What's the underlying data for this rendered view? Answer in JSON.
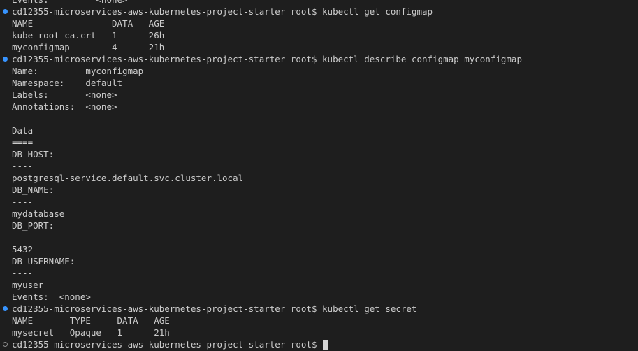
{
  "terminal": {
    "prompt": "cd12355-microservices-aws-kubernetes-project-starter root$",
    "lines": [
      {
        "type": "output",
        "text": "Events:         <none>"
      },
      {
        "type": "command",
        "status": "done",
        "text": "cd12355-microservices-aws-kubernetes-project-starter root$ kubectl get configmap"
      },
      {
        "type": "output",
        "text": "NAME               DATA   AGE"
      },
      {
        "type": "output",
        "text": "kube-root-ca.crt   1      26h"
      },
      {
        "type": "output",
        "text": "myconfigmap        4      21h"
      },
      {
        "type": "command",
        "status": "done",
        "text": "cd12355-microservices-aws-kubernetes-project-starter root$ kubectl describe configmap myconfigmap"
      },
      {
        "type": "output",
        "text": "Name:         myconfigmap"
      },
      {
        "type": "output",
        "text": "Namespace:    default"
      },
      {
        "type": "output",
        "text": "Labels:       <none>"
      },
      {
        "type": "output",
        "text": "Annotations:  <none>"
      },
      {
        "type": "output",
        "text": ""
      },
      {
        "type": "output",
        "text": "Data"
      },
      {
        "type": "output",
        "text": "===="
      },
      {
        "type": "output",
        "text": "DB_HOST:"
      },
      {
        "type": "output",
        "text": "----"
      },
      {
        "type": "output",
        "text": "postgresql-service.default.svc.cluster.local"
      },
      {
        "type": "output",
        "text": "DB_NAME:"
      },
      {
        "type": "output",
        "text": "----"
      },
      {
        "type": "output",
        "text": "mydatabase"
      },
      {
        "type": "output",
        "text": "DB_PORT:"
      },
      {
        "type": "output",
        "text": "----"
      },
      {
        "type": "output",
        "text": "5432"
      },
      {
        "type": "output",
        "text": "DB_USERNAME:"
      },
      {
        "type": "output",
        "text": "----"
      },
      {
        "type": "output",
        "text": "myuser"
      },
      {
        "type": "output",
        "text": "Events:  <none>"
      },
      {
        "type": "command",
        "status": "done",
        "text": "cd12355-microservices-aws-kubernetes-project-starter root$ kubectl get secret"
      },
      {
        "type": "output",
        "text": "NAME       TYPE     DATA   AGE"
      },
      {
        "type": "output",
        "text": "mysecret   Opaque   1      21h"
      },
      {
        "type": "command",
        "status": "pending",
        "text": "cd12355-microservices-aws-kubernetes-project-starter root$ ",
        "cursor": true
      }
    ],
    "colors": {
      "background": "#1e1e1e",
      "foreground": "#cccccc",
      "marker_done": "#3794ff",
      "marker_pending": "#8b8b8b"
    }
  }
}
